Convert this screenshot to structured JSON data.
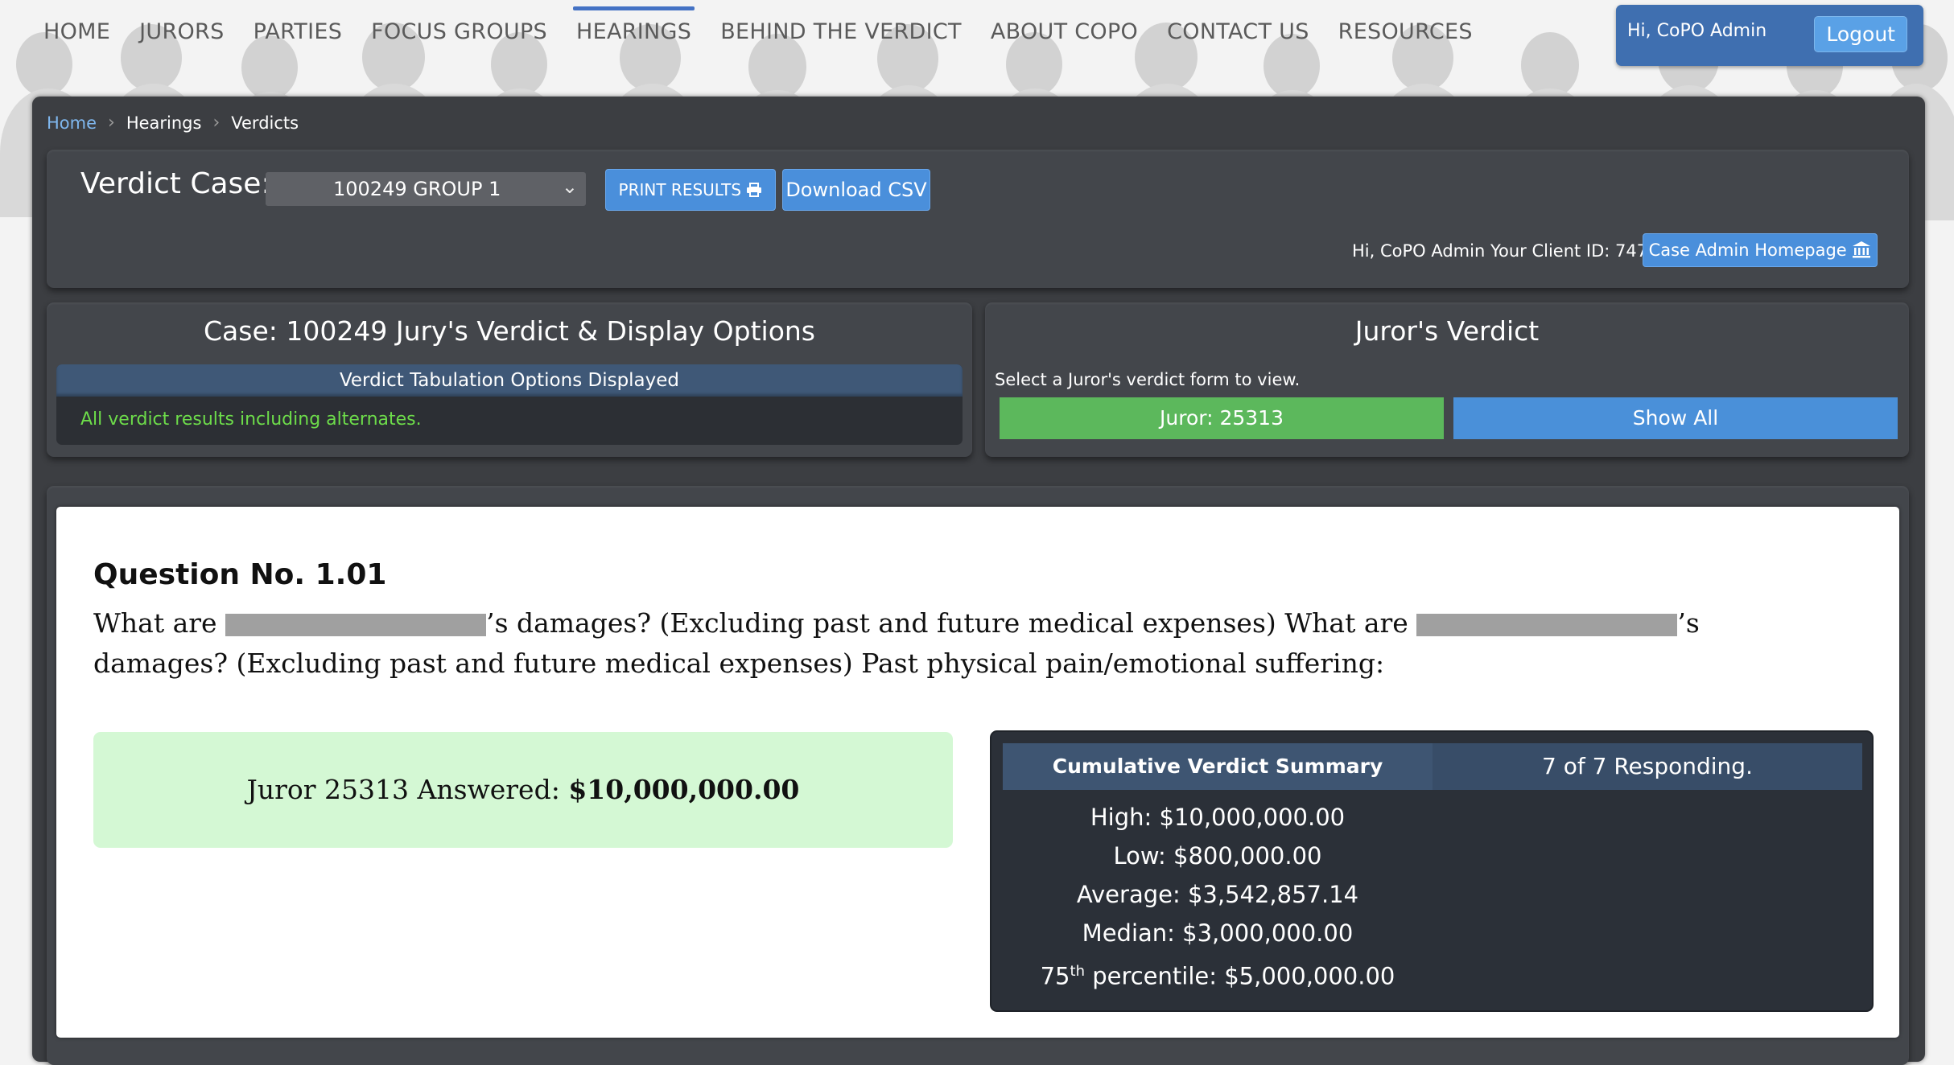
{
  "nav": {
    "items": [
      "HOME",
      "JURORS",
      "PARTIES",
      "FOCUS GROUPS",
      "HEARINGS",
      "BEHIND THE VERDICT",
      "ABOUT COPO",
      "CONTACT US",
      "RESOURCES"
    ],
    "active": "HEARINGS"
  },
  "user": {
    "greeting": "Hi, CoPO Admin",
    "logout_label": "Logout"
  },
  "breadcrumb": {
    "home": "Home",
    "hearings": "Hearings",
    "current": "Verdicts"
  },
  "verdict_case": {
    "label": "Verdict Case:",
    "selected": "100249 GROUP 1",
    "print_label": "PRINT RESULTS",
    "csv_label": "Download CSV",
    "client_text": "Hi, CoPO Admin Your Client ID: 747",
    "case_admin_label": "Case Admin Homepage"
  },
  "options_panel": {
    "title": "Case: 100249 Jury's Verdict & Display Options",
    "header": "Verdict Tabulation Options Displayed",
    "text": "All verdict results including alternates."
  },
  "jurors_panel": {
    "title": "Juror's Verdict",
    "subtitle": "Select a Juror's verdict form to view.",
    "juror_button": "Juror: 25313",
    "show_all_button": "Show All"
  },
  "question": {
    "number": "Question No. 1.01",
    "text_1": "What are",
    "text_2": "’s damages? (Excluding past and future medical expenses) What are",
    "text_3": "’s damages? (Excluding past and future medical expenses) Past physical pain/emotional suffering:",
    "answer_prefix": "Juror 25313 Answered:",
    "answer_value": "$10,000,000.00"
  },
  "summary": {
    "title": "Cumulative Verdict Summary",
    "responding": "7 of 7 Responding.",
    "high": "High: $10,000,000.00",
    "low": "Low: $800,000.00",
    "average": "Average: $3,542,857.14",
    "median": "Median: $3,000,000.00",
    "p75_prefix": "75",
    "p75_sup": "th",
    "p75_rest": " percentile: $5,000,000.00"
  },
  "colors": {
    "accent_blue": "#4a8fdb",
    "juror_green": "#5cb85c",
    "panel_dark": "#3c3e42",
    "answer_green_bg": "#d4f8d4",
    "option_text_green": "#6ddc4a"
  },
  "icons": [
    "print-icon",
    "bank-icon",
    "chevron-down-icon",
    "chevron-right-icon"
  ]
}
